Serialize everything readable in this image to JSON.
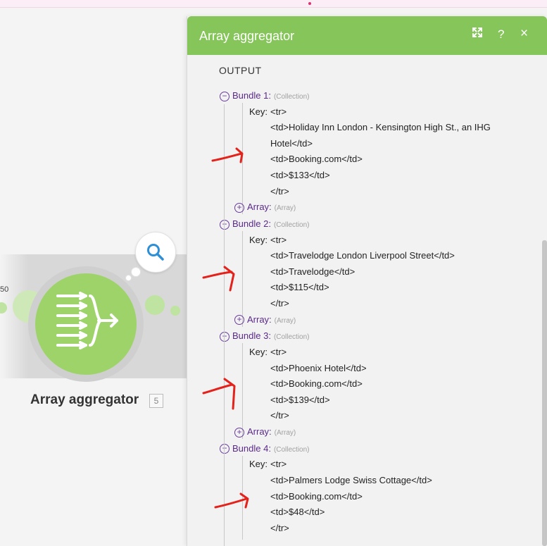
{
  "canvas": {
    "small_number": "50",
    "module_label": "Array aggregator",
    "module_badge": "5"
  },
  "panel": {
    "title": "Array aggregator",
    "expand_icon": "expand-icon",
    "help_label": "?",
    "close_label": "×",
    "output_title": "OUTPUT",
    "colors": {
      "header": "#85c55a",
      "module": "#9ed36a",
      "annotation": "#e3221b"
    },
    "bundles": [
      {
        "label": "Bundle 1:",
        "type": "(Collection)",
        "key_label": "Key:",
        "key_first": "<tr>",
        "lines": [
          "<td>Holiday Inn London - Kensington High St., an IHG",
          "Hotel</td>",
          "<td>Booking.com</td>",
          "<td>$133</td>",
          "</tr>"
        ],
        "array_label": "Array:",
        "array_type": "(Array)"
      },
      {
        "label": "Bundle 2:",
        "type": "(Collection)",
        "key_label": "Key:",
        "key_first": "<tr>",
        "lines": [
          "<td>Travelodge London Liverpool Street</td>",
          "<td>Travelodge</td>",
          "<td>$115</td>",
          "</tr>"
        ],
        "array_label": "Array:",
        "array_type": "(Array)"
      },
      {
        "label": "Bundle 3:",
        "type": "(Collection)",
        "key_label": "Key:",
        "key_first": "<tr>",
        "lines": [
          "<td>Phoenix Hotel</td>",
          "<td>Booking.com</td>",
          "<td>$139</td>",
          "</tr>"
        ],
        "array_label": "Array:",
        "array_type": "(Array)"
      },
      {
        "label": "Bundle 4:",
        "type": "(Collection)",
        "key_label": "Key:",
        "key_first": "<tr>",
        "lines": [
          "<td>Palmers Lodge Swiss Cottage</td>",
          "<td>Booking.com</td>",
          "<td>$48</td>",
          "</tr>"
        ]
      }
    ]
  }
}
